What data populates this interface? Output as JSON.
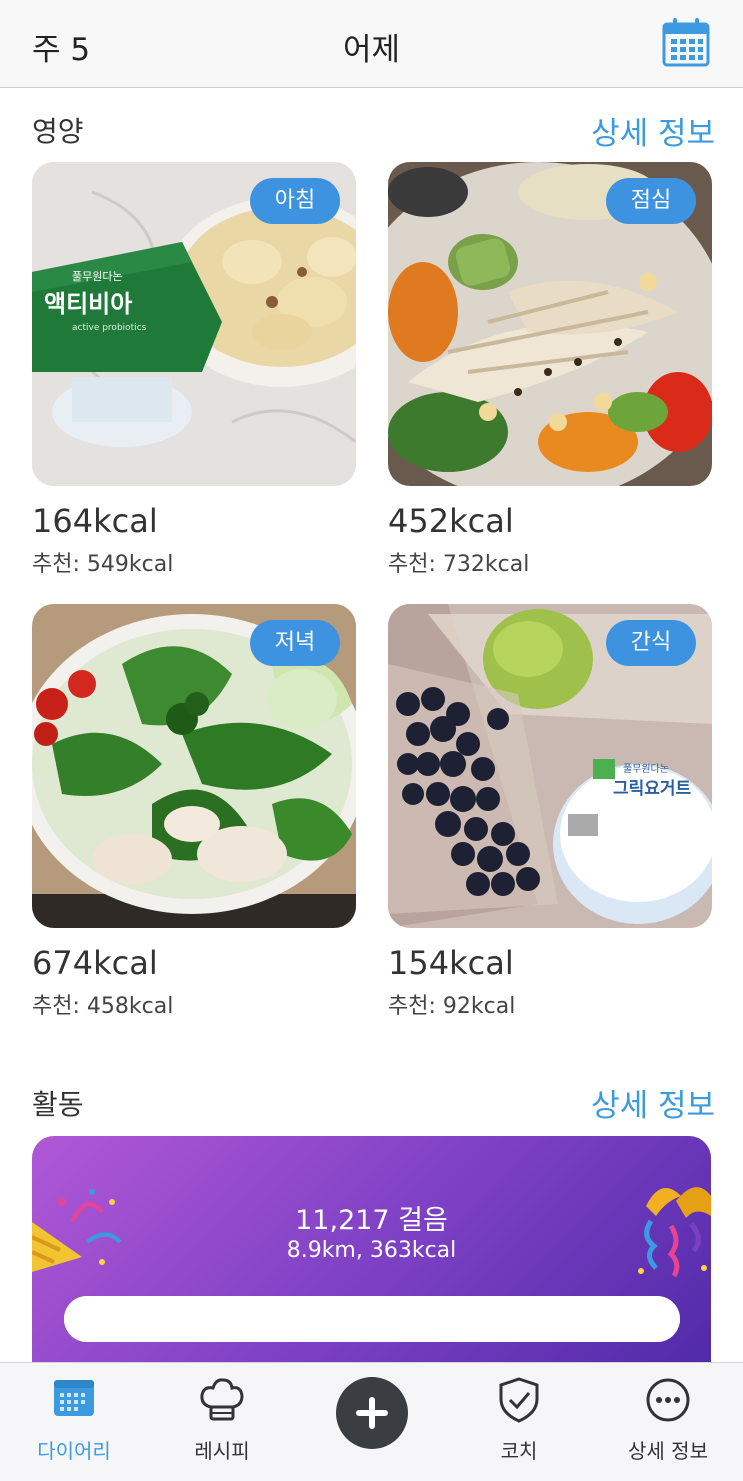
{
  "header": {
    "week": "주 5",
    "title": "어제",
    "calendar_icon": "calendar-icon"
  },
  "nutrition": {
    "title": "영양",
    "more": "상세 정보",
    "meals": [
      {
        "badge": "아침",
        "kcal": "164kcal",
        "rec": "추천: 549kcal",
        "photo": "yogurt-banana-breakfast"
      },
      {
        "badge": "점심",
        "kcal": "452kcal",
        "rec": "추천: 732kcal",
        "photo": "chicken-salad-lunch"
      },
      {
        "badge": "저녁",
        "kcal": "674kcal",
        "rec": "추천: 458kcal",
        "photo": "green-salad-dinner"
      },
      {
        "badge": "간식",
        "kcal": "154kcal",
        "rec": "추천: 92kcal",
        "photo": "blueberries-yogurt-snack"
      }
    ]
  },
  "activity": {
    "title": "활동",
    "more": "상세 정보",
    "steps": "11,217 걸음",
    "detail": "8.9km, 363kcal",
    "colors": {
      "start": "#b058d6",
      "end": "#4f2aa8"
    }
  },
  "tabbar": {
    "items": [
      {
        "label": "다이어리",
        "icon": "diary-calendar-icon",
        "active": true
      },
      {
        "label": "레시피",
        "icon": "chef-hat-icon",
        "active": false
      },
      {
        "label": "",
        "icon": "plus-icon",
        "active": false
      },
      {
        "label": "코치",
        "icon": "shield-check-icon",
        "active": false
      },
      {
        "label": "상세 정보",
        "icon": "more-dots-icon",
        "active": false
      }
    ]
  },
  "colors": {
    "accent": "#3c9be0",
    "badge": "#3d93e0"
  }
}
